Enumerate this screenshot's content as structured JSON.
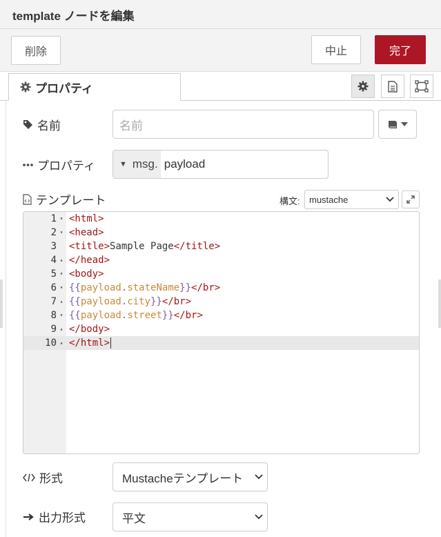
{
  "header": {
    "title": "template ノードを編集"
  },
  "toolbar": {
    "delete_label": "削除",
    "cancel_label": "中止",
    "done_label": "完了",
    "done_color": "#ad1625"
  },
  "tabs": {
    "properties_label": "プロパティ",
    "icons": [
      "gear-icon",
      "description-icon",
      "appearance-icon"
    ]
  },
  "fields": {
    "name": {
      "label": "名前",
      "placeholder": "名前",
      "value": ""
    },
    "property": {
      "label": "プロパティ",
      "type": "msg.",
      "value": "payload"
    },
    "template": {
      "label": "テンプレート",
      "syntax_label": "構文:",
      "syntax_value": "mustache"
    },
    "format": {
      "label": "形式",
      "value": "Mustacheテンプレート"
    },
    "output": {
      "label": "出力形式",
      "value": "平文"
    }
  },
  "editor": {
    "active_line": 10,
    "lines": [
      {
        "n": "1",
        "fold": "▾",
        "code": "<html>"
      },
      {
        "n": "2",
        "fold": "▾",
        "code": "<head>"
      },
      {
        "n": "3",
        "fold": "",
        "code": "<title>Sample Page</title>"
      },
      {
        "n": "4",
        "fold": "▴",
        "code": "</head>"
      },
      {
        "n": "5",
        "fold": "▾",
        "code": "<body>"
      },
      {
        "n": "6",
        "fold": "▾",
        "code": "{{payload.stateName}}</br>"
      },
      {
        "n": "7",
        "fold": "▴",
        "code": "{{payload.city}}</br>"
      },
      {
        "n": "8",
        "fold": "▾",
        "code": "{{payload.street}}</br>"
      },
      {
        "n": "9",
        "fold": "▴",
        "code": "</body>"
      },
      {
        "n": "10",
        "fold": "▴",
        "code": "</html>"
      }
    ]
  }
}
